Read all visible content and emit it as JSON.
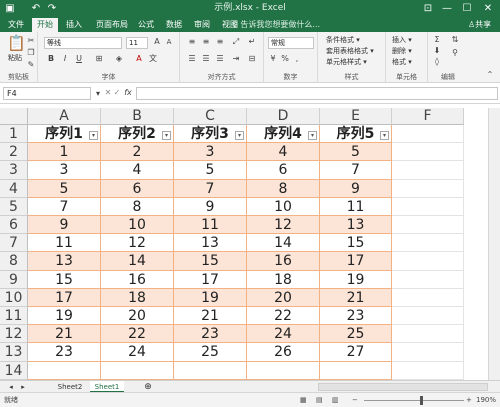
{
  "titlebar": {
    "title": "示例.xlsx - Excel",
    "undo": "↶",
    "redo": "↷",
    "min": "—",
    "max": "☐",
    "close": "✕",
    "ribbon_opts": "⊡"
  },
  "tabs": [
    "文件",
    "开始",
    "插入",
    "页面布局",
    "公式",
    "数据",
    "审阅",
    "视图"
  ],
  "active_tab": 1,
  "tellme": "♀ 告诉我您想要做什么...",
  "share": "♙共享",
  "ribbon": {
    "clipboard": {
      "label": "剪贴板",
      "paste": "粘贴"
    },
    "font": {
      "label": "字体",
      "name": "等线",
      "size": "11",
      "bold": "B",
      "italic": "I",
      "underline": "U"
    },
    "align": {
      "label": "对齐方式"
    },
    "number": {
      "label": "数字",
      "format": "常规",
      "percent": "%"
    },
    "styles": {
      "label": "样式",
      "items": [
        "条件格式 ▾",
        "套用表格格式 ▾",
        "单元格样式 ▾"
      ]
    },
    "cells": {
      "label": "单元格",
      "items": [
        "插入 ▾",
        "删除 ▾",
        "格式 ▾"
      ]
    },
    "edit": {
      "label": "编辑"
    }
  },
  "formula": {
    "namebox": "F4",
    "fx": "fx"
  },
  "columns": [
    "A",
    "B",
    "C",
    "D",
    "E",
    "F"
  ],
  "header_row": [
    "序列1",
    "序列2",
    "序列3",
    "序列4",
    "序列5"
  ],
  "rows": [
    [
      "1",
      "2",
      "3",
      "4",
      "5"
    ],
    [
      "3",
      "4",
      "5",
      "6",
      "7"
    ],
    [
      "5",
      "6",
      "7",
      "8",
      "9"
    ],
    [
      "7",
      "8",
      "9",
      "10",
      "11"
    ],
    [
      "9",
      "10",
      "11",
      "12",
      "13"
    ],
    [
      "11",
      "12",
      "13",
      "14",
      "15"
    ],
    [
      "13",
      "14",
      "15",
      "16",
      "17"
    ],
    [
      "15",
      "16",
      "17",
      "18",
      "19"
    ],
    [
      "17",
      "18",
      "19",
      "20",
      "21"
    ],
    [
      "19",
      "20",
      "21",
      "22",
      "23"
    ],
    [
      "21",
      "22",
      "23",
      "24",
      "25"
    ],
    [
      "23",
      "24",
      "25",
      "26",
      "27"
    ]
  ],
  "row_numbers": [
    "1",
    "2",
    "3",
    "4",
    "5",
    "6",
    "7",
    "8",
    "9",
    "10",
    "11",
    "12",
    "13",
    "14"
  ],
  "sheets": [
    "Sheet2",
    "Sheet1"
  ],
  "active_sheet": 1,
  "status": {
    "ready": "就绪",
    "zoom": "190%"
  },
  "colors": {
    "excel_green": "#217346",
    "band": "#fce4d6",
    "border": "#f4b183"
  }
}
